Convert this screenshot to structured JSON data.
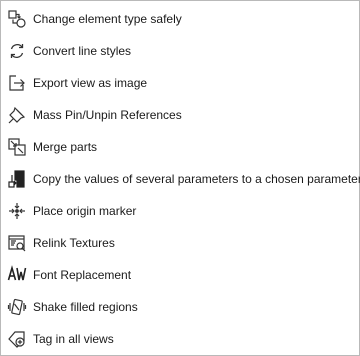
{
  "menu": {
    "items": [
      {
        "label": "Change element type safely",
        "icon": "change-type-icon"
      },
      {
        "label": "Convert line styles",
        "icon": "convert-arrows-icon"
      },
      {
        "label": "Export view as image",
        "icon": "export-arrow-icon"
      },
      {
        "label": "Mass Pin/Unpin References",
        "icon": "pin-icon"
      },
      {
        "label": "Merge parts",
        "icon": "merge-parts-icon"
      },
      {
        "label": "Copy the values of several parameters to a chosen parameter",
        "icon": "copy-parameters-icon"
      },
      {
        "label": "Place origin marker",
        "icon": "origin-marker-icon"
      },
      {
        "label": "Relink Textures",
        "icon": "relink-textures-icon"
      },
      {
        "label": "Font Replacement",
        "icon": "font-replacement-icon"
      },
      {
        "label": "Shake filled regions",
        "icon": "shake-regions-icon"
      },
      {
        "label": "Tag in all views",
        "icon": "tag-plus-icon"
      }
    ]
  },
  "colors": {
    "border": "#b9b9b9",
    "text": "#1a1a1a",
    "icon_stroke": "#333333"
  }
}
